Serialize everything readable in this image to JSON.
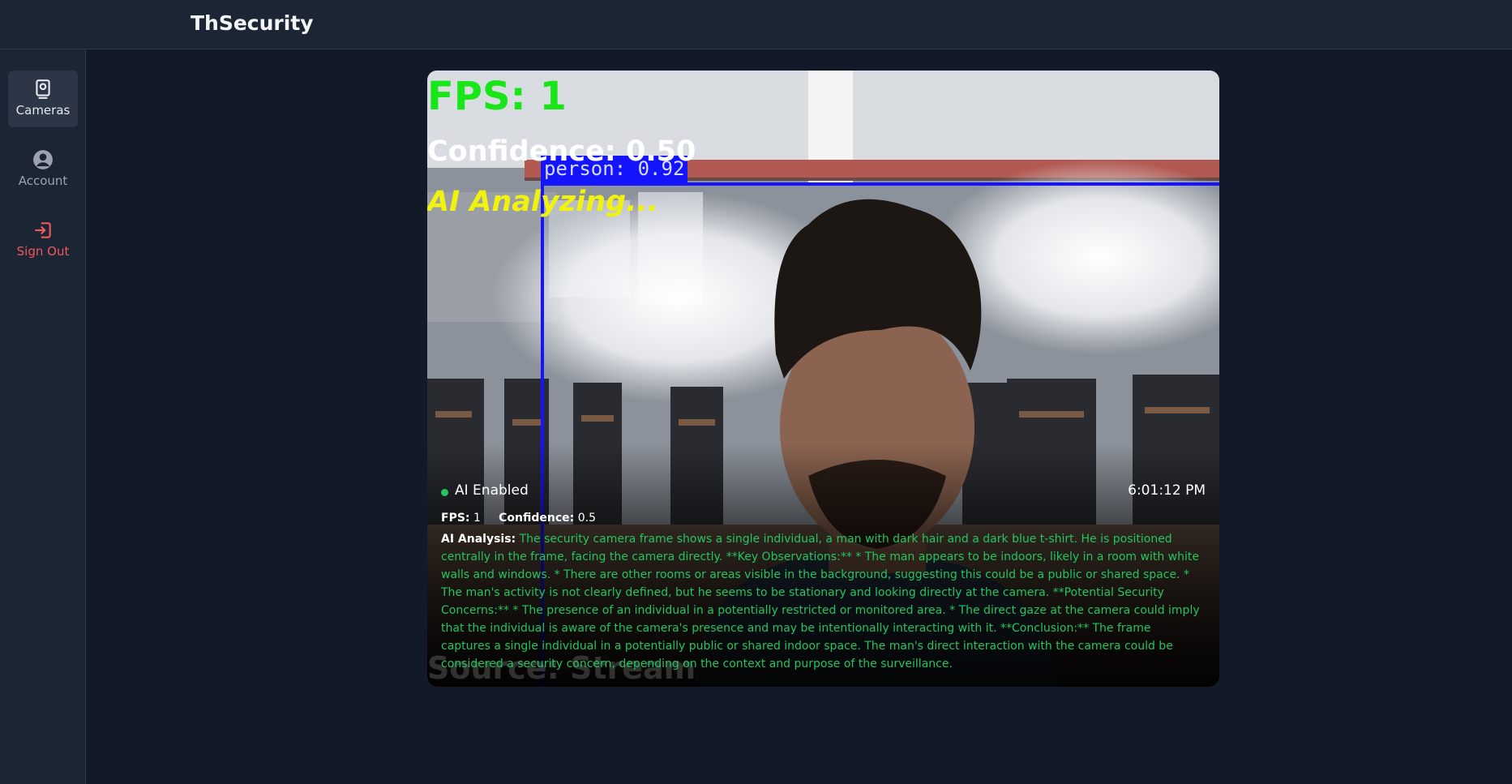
{
  "app": {
    "title": "ThSecurity"
  },
  "sidebar": {
    "items": [
      {
        "label": "Cameras",
        "icon": "camera-icon",
        "active": true
      },
      {
        "label": "Account",
        "icon": "user-circle-icon",
        "active": false
      },
      {
        "label": "Sign Out",
        "icon": "sign-out-icon",
        "active": false
      }
    ]
  },
  "camera": {
    "overlay": {
      "fps_text": "FPS: 1",
      "confidence_text": "Confidence: 0.50",
      "ai_text": "AI Analyzing...",
      "source_text": "Source: Stream",
      "detection_label": "person: 0.92"
    },
    "status": {
      "ai_label": "AI Enabled",
      "time": "6:01:12 PM",
      "fps_label": "FPS:",
      "fps_value": "1",
      "confidence_label": "Confidence:",
      "confidence_value": "0.5"
    },
    "analysis": {
      "label": "AI Analysis:",
      "text": "The security camera frame shows a single individual, a man with dark hair and a dark blue t-shirt. He is positioned centrally in the frame, facing the camera directly. **Key Observations:** * The man appears to be indoors, likely in a room with white walls and windows. * There are other rooms or areas visible in the background, suggesting this could be a public or shared space. * The man's activity is not clearly defined, but he seems to be stationary and looking directly at the camera. **Potential Security Concerns:** * The presence of an individual in a potentially restricted or monitored area. * The direct gaze at the camera could imply that the individual is aware of the camera's presence and may be intentionally interacting with it. **Conclusion:** The frame captures a single individual in a potentially public or shared indoor space. The man's direct interaction with the camera could be considered a security concern, depending on the context and purpose of the surveillance."
    }
  },
  "colors": {
    "accent_green": "#22c55e",
    "sign_out_red": "#f0585c",
    "detection_blue": "#1414ff"
  }
}
